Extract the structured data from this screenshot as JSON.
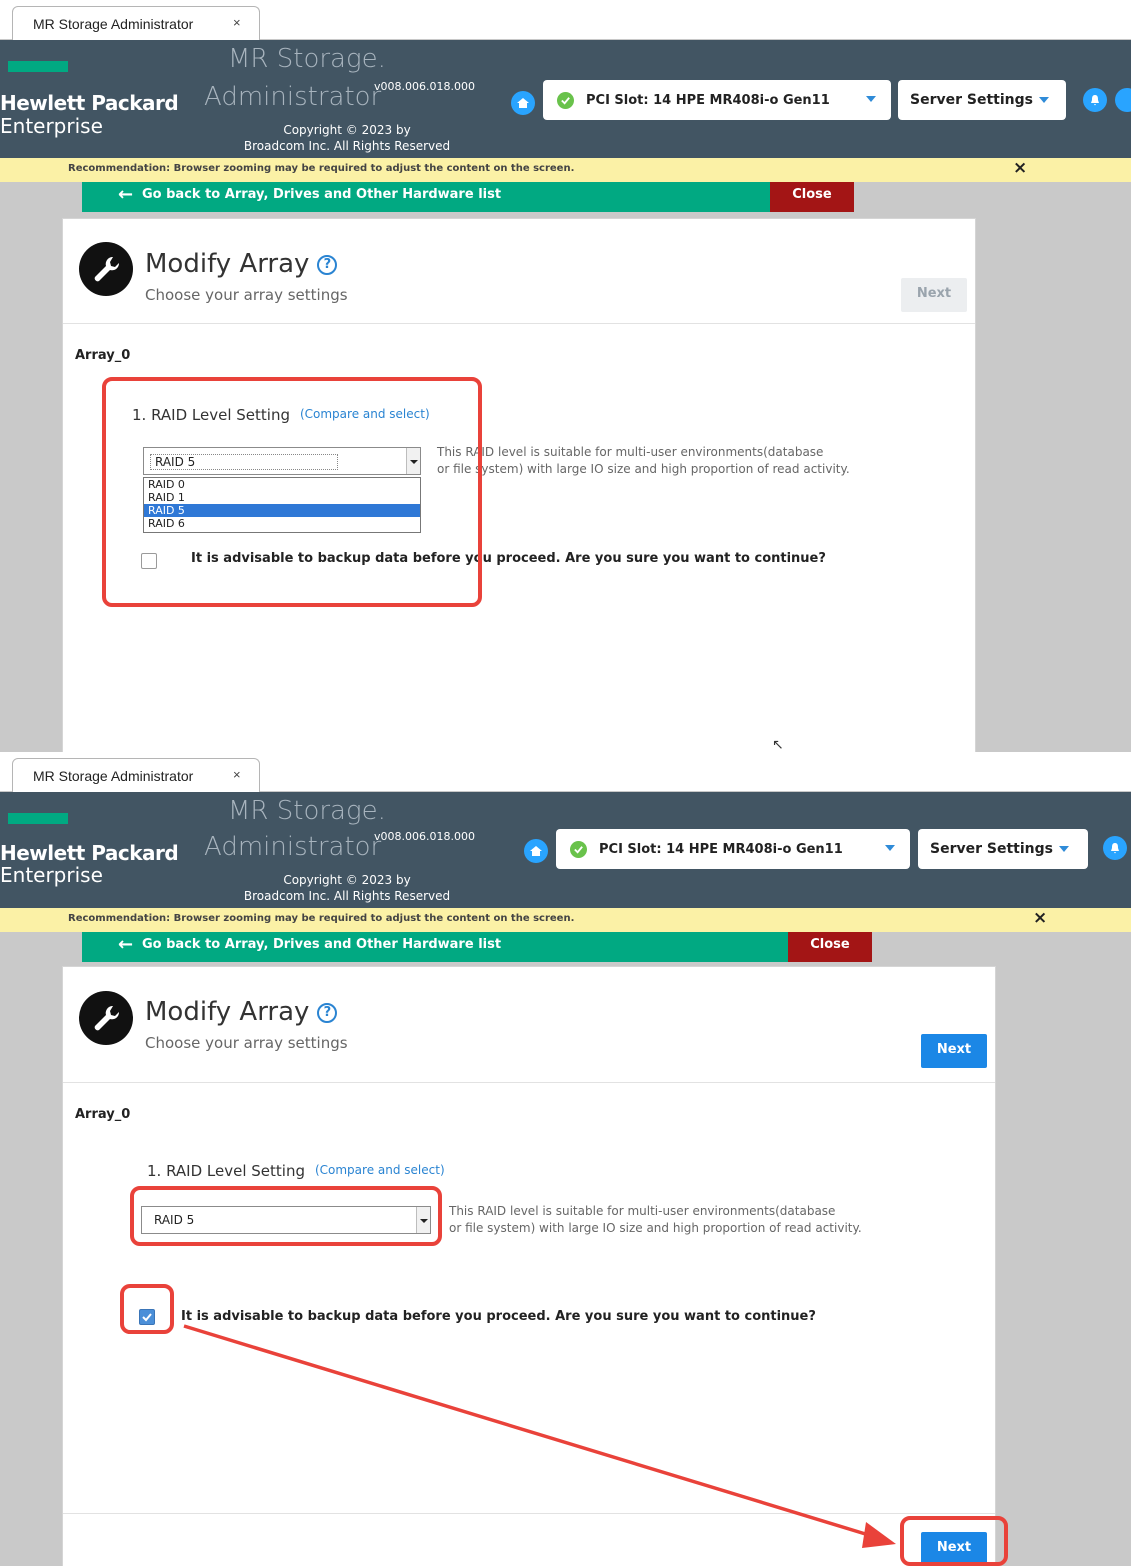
{
  "browser": {
    "tab_title": "MR Storage Administrator",
    "tab_close": "×"
  },
  "header": {
    "brand_line1": "Hewlett Packard",
    "brand_line2": "Enterprise",
    "app_name_line1": "MR Storage.",
    "app_name_line2": "Administrator",
    "version": "v008.006.018.000",
    "copyright_line1": "Copyright © 2023 by",
    "copyright_line2": "Broadcom Inc. All Rights Reserved",
    "controller_label": "PCI Slot: 14 HPE MR408i-o Gen11",
    "server_settings_label": "Server Settings"
  },
  "recommendation": {
    "text": "Recommendation: Browser zooming may be required to adjust the content on the screen.",
    "close": "×"
  },
  "nav": {
    "back_label": "Go back to Array, Drives and Other Hardware list",
    "back_arrow": "←",
    "close_label": "Close"
  },
  "page": {
    "title": "Modify Array",
    "help": "?",
    "subtitle": "Choose your array settings",
    "next_label": "Next",
    "array_name": "Array_0",
    "raid_heading": "1. RAID Level Setting",
    "compare_link": "(Compare and select)",
    "raid_selected": "RAID 5",
    "raid_options": [
      "RAID 0",
      "RAID 1",
      "RAID 5",
      "RAID 6"
    ],
    "raid_desc_line1": "This RAID level is suitable for multi-user environments(database",
    "raid_desc_line2": "or file system) with large IO size and high proportion of read activity.",
    "confirm_text": "It is advisable to backup data before you proceed. Are you sure you want to continue?"
  },
  "state": {
    "shot1_next_enabled": false,
    "shot2_next_enabled": true,
    "shot2_checkbox_checked": true
  },
  "colors": {
    "header_bg": "#425563",
    "hpe_green": "#01a982",
    "close_red": "#a31515",
    "recommend_yellow": "#fbf1a6",
    "accent_blue": "#1b87e6",
    "annotation_red": "#e9423a"
  }
}
